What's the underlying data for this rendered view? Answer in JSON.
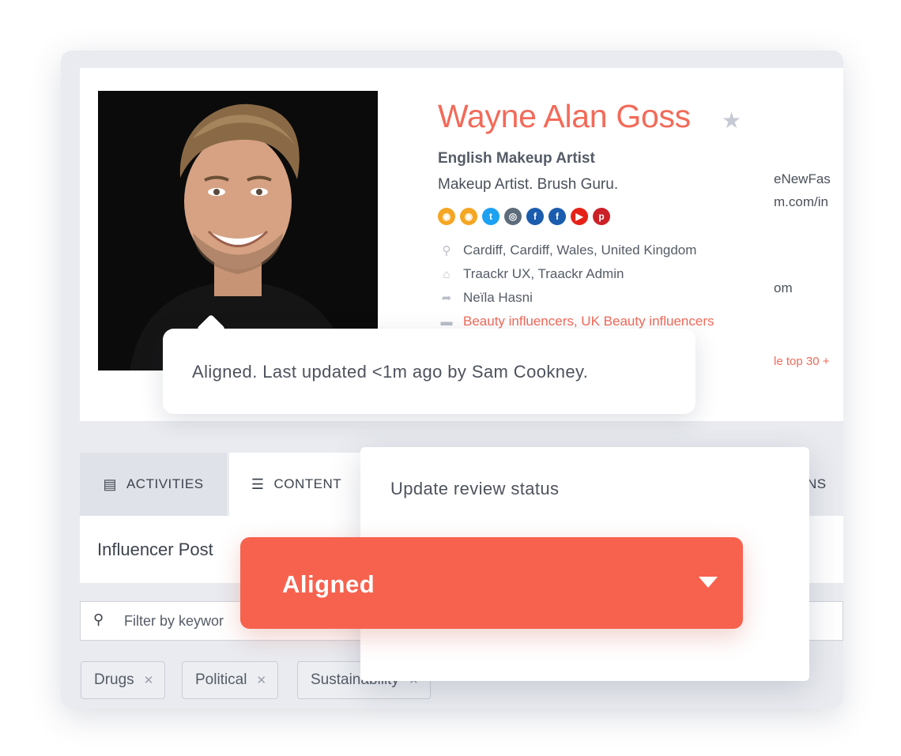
{
  "profile": {
    "name": "Wayne Alan Goss",
    "title": "English Makeup Artist",
    "subtitle": "Makeup Artist. Brush Guru.",
    "socials": [
      "rss",
      "rss",
      "twitter",
      "instagram",
      "facebook",
      "facebook",
      "youtube",
      "pinterest"
    ],
    "location": "Cardiff, Cardiff, Wales, United Kingdom",
    "owners": "Traackr UX, Traackr Admin",
    "assignee": "Neïla Hasni",
    "lists": "Beauty influencers, UK Beauty influencers",
    "right_line1": "eNewFas",
    "right_line2": "m.com/in",
    "right_line3": "om",
    "right_line4": "le top 30 +"
  },
  "tooltip": {
    "text": "Aligned. Last updated <1m ago by Sam Cookney."
  },
  "tabs": {
    "activities": "ACTIVITIES",
    "content": "CONTENT",
    "partial_right": "NS"
  },
  "posts": {
    "title": "Influencer Post"
  },
  "filter": {
    "placeholder": "Filter by keywor"
  },
  "chips": [
    {
      "label": "Drugs"
    },
    {
      "label": "Political"
    },
    {
      "label": "Sustainability"
    }
  ],
  "review": {
    "header": "Update review status",
    "selected": "Aligned"
  },
  "colors": {
    "accent": "#f7624f",
    "name": "#f36a59"
  }
}
